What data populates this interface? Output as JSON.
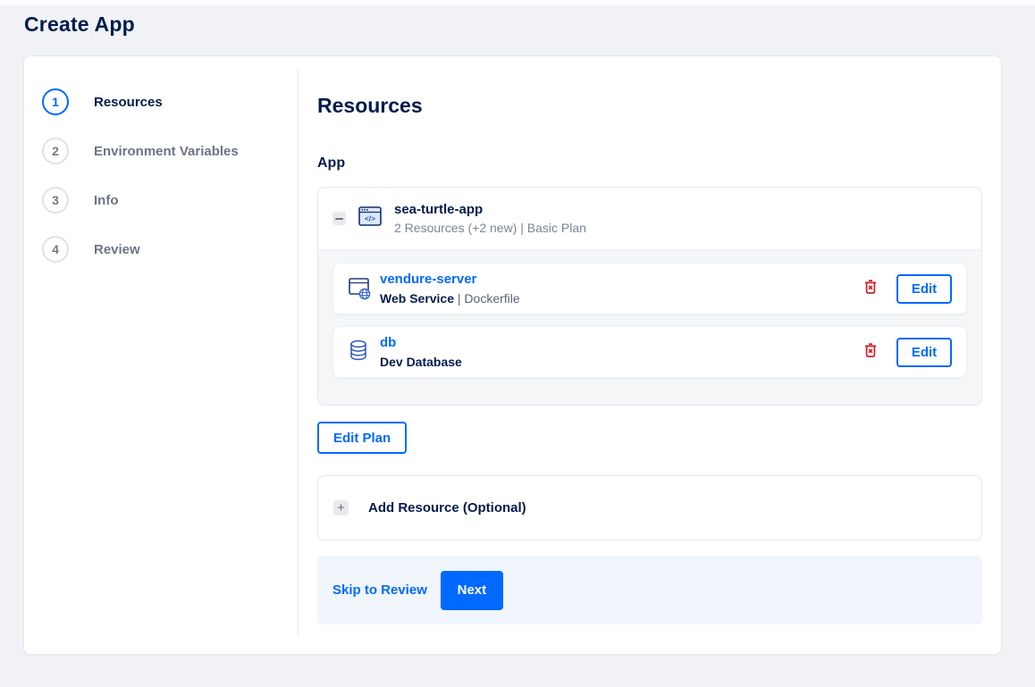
{
  "page_title": "Create App",
  "colors": {
    "accent": "#0069ff",
    "navy": "#031b4e",
    "danger": "#cc2027",
    "page_bg": "#f0f2f6",
    "footer_bg": "#f0f6fb"
  },
  "stepper": {
    "items": [
      {
        "number": "1",
        "label": "Resources",
        "active": true
      },
      {
        "number": "2",
        "label": "Environment Variables",
        "active": false
      },
      {
        "number": "3",
        "label": "Info",
        "active": false
      },
      {
        "number": "4",
        "label": "Review",
        "active": false
      }
    ]
  },
  "content": {
    "heading": "Resources",
    "section_label": "App",
    "app": {
      "name": "sea-turtle-app",
      "summary": "2 Resources (+2 new) | Basic Plan",
      "resources": [
        {
          "name": "vendure-server",
          "type": "Web Service",
          "detail_rest": " | Dockerfile",
          "icon": "web-service-icon",
          "edit_label": "Edit"
        },
        {
          "name": "db",
          "type": "Dev Database",
          "detail_rest": "",
          "icon": "database-icon",
          "edit_label": "Edit"
        }
      ]
    },
    "edit_plan_label": "Edit Plan",
    "add_resource_label": "Add Resource (Optional)",
    "footer": {
      "skip_label": "Skip to Review",
      "next_label": "Next"
    }
  }
}
